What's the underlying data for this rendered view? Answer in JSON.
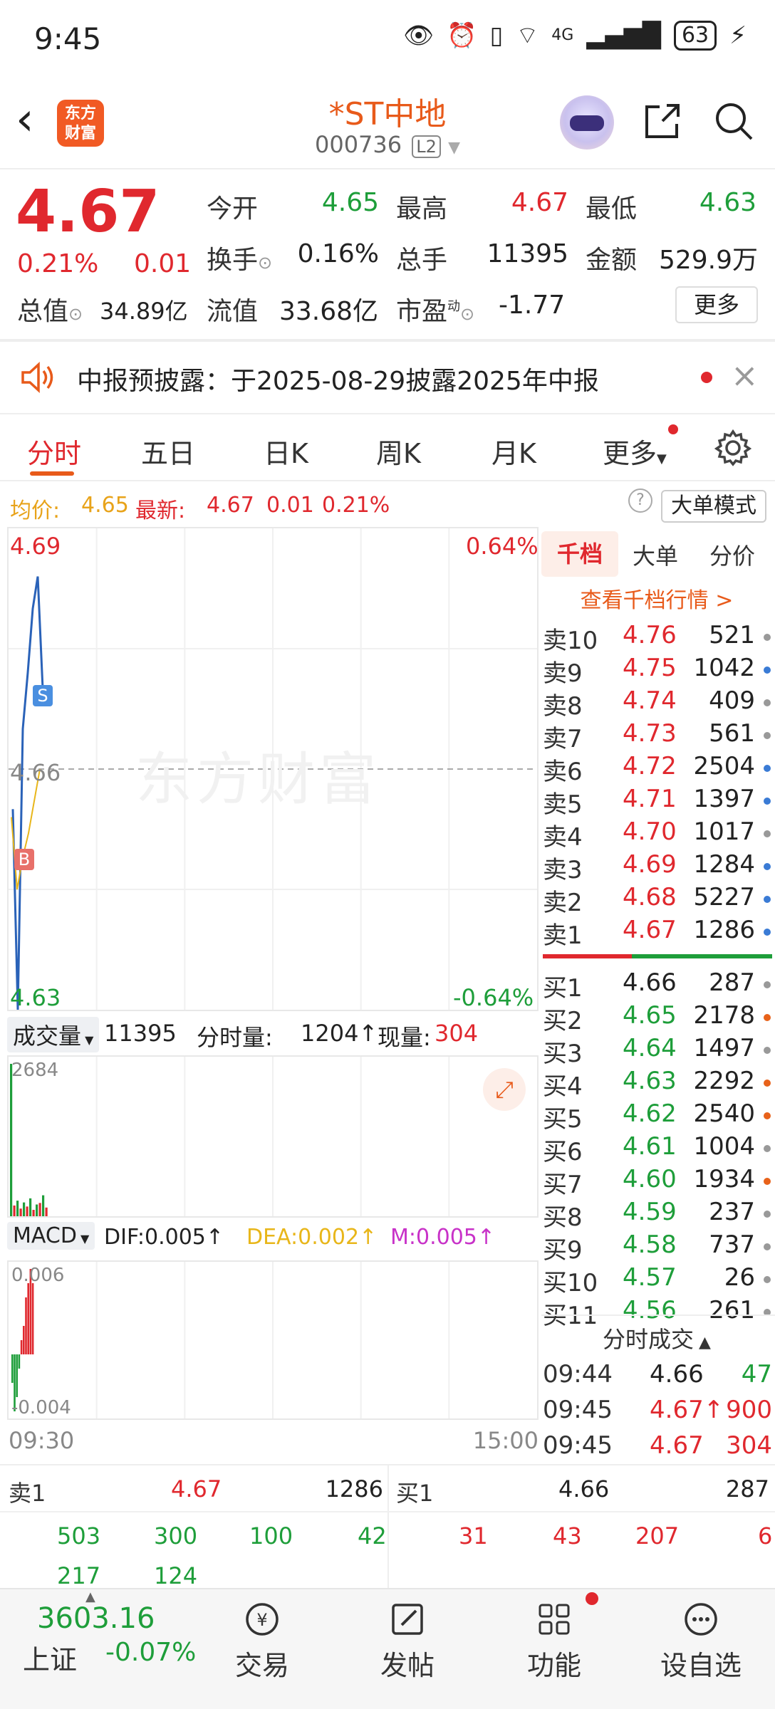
{
  "status": {
    "time": "9:45",
    "network": "4G",
    "battery": "63"
  },
  "header": {
    "logo_line1": "东方",
    "logo_line2": "财富",
    "stock_name": "*ST中地",
    "stock_code": "000736",
    "level_badge": "L2"
  },
  "quote": {
    "price": "4.67",
    "change_pct": "0.21%",
    "change_abs": "0.01",
    "open_label": "今开",
    "open": "4.65",
    "high_label": "最高",
    "high": "4.67",
    "low_label": "最低",
    "low": "4.63",
    "turnover_label": "换手",
    "turnover": "0.16%",
    "volume_label": "总手",
    "volume": "11395",
    "amount_label": "金额",
    "amount": "529.9万",
    "mktcap_label": "总值",
    "mktcap": "34.89亿",
    "float_label": "流值",
    "float_cap": "33.68亿",
    "pe_label": "市盈",
    "pe_sup": "动",
    "pe": "-1.77",
    "more_label": "更多"
  },
  "notice": {
    "text": "中报预披露：于2025-08-29披露2025年中报"
  },
  "tabs": [
    {
      "label": "分时"
    },
    {
      "label": "五日"
    },
    {
      "label": "日K"
    },
    {
      "label": "周K"
    },
    {
      "label": "月K"
    },
    {
      "label": "更多"
    }
  ],
  "subhead": {
    "avg_label": "均价:",
    "avg": "4.65",
    "latest_label": "最新:",
    "latest": "4.67",
    "latest_chg": "0.01",
    "latest_pct": "0.21%",
    "mode_btn": "大单模式"
  },
  "chart": {
    "y_top": "4.69",
    "y_mid": "4.66",
    "y_bottom": "4.63",
    "pct_top": "0.64%",
    "pct_bottom": "-0.64%",
    "watermark": "东方财富",
    "marker_b": "B",
    "marker_s": "S"
  },
  "volume": {
    "dropdown": "成交量",
    "total": "11395",
    "tick_label": "分时量:",
    "tick_val": "1204",
    "now_label": "现量:",
    "now_val": "304",
    "max": "2684"
  },
  "macd": {
    "dropdown": "MACD",
    "dif": "DIF:0.005",
    "dea": "DEA:0.002",
    "m": "M:0.005",
    "top": "0.006",
    "bottom": "-0.004"
  },
  "time_axis": {
    "start": "09:30",
    "end": "15:00"
  },
  "orderbook": {
    "tabs": [
      "千档",
      "大单",
      "分价"
    ],
    "link": "查看千档行情 >",
    "asks": [
      {
        "label": "卖10",
        "price": "4.76",
        "qty": "521",
        "dot": "#999999"
      },
      {
        "label": "卖9",
        "price": "4.75",
        "qty": "1042",
        "dot": "#3a7bd5"
      },
      {
        "label": "卖8",
        "price": "4.74",
        "qty": "409",
        "dot": "#999999"
      },
      {
        "label": "卖7",
        "price": "4.73",
        "qty": "561",
        "dot": "#999999"
      },
      {
        "label": "卖6",
        "price": "4.72",
        "qty": "2504",
        "dot": "#3a7bd5"
      },
      {
        "label": "卖5",
        "price": "4.71",
        "qty": "1397",
        "dot": "#3a7bd5"
      },
      {
        "label": "卖4",
        "price": "4.70",
        "qty": "1017",
        "dot": "#999999"
      },
      {
        "label": "卖3",
        "price": "4.69",
        "qty": "1284",
        "dot": "#3a7bd5"
      },
      {
        "label": "卖2",
        "price": "4.68",
        "qty": "5227",
        "dot": "#3a7bd5"
      },
      {
        "label": "卖1",
        "price": "4.67",
        "qty": "1286",
        "dot": "#3a7bd5"
      }
    ],
    "bids": [
      {
        "label": "买1",
        "price": "4.66",
        "qty": "287",
        "dot": "#999999"
      },
      {
        "label": "买2",
        "price": "4.65",
        "qty": "2178",
        "dot": "#e8621a"
      },
      {
        "label": "买3",
        "price": "4.64",
        "qty": "1497",
        "dot": "#999999"
      },
      {
        "label": "买4",
        "price": "4.63",
        "qty": "2292",
        "dot": "#e8621a"
      },
      {
        "label": "买5",
        "price": "4.62",
        "qty": "2540",
        "dot": "#e8621a"
      },
      {
        "label": "买6",
        "price": "4.61",
        "qty": "1004",
        "dot": "#999999"
      },
      {
        "label": "买7",
        "price": "4.60",
        "qty": "1934",
        "dot": "#e8621a"
      },
      {
        "label": "买8",
        "price": "4.59",
        "qty": "237",
        "dot": "#999999"
      },
      {
        "label": "买9",
        "price": "4.58",
        "qty": "737",
        "dot": "#999999"
      },
      {
        "label": "买10",
        "price": "4.57",
        "qty": "26",
        "dot": "#999999"
      },
      {
        "label": "买11",
        "price": "4.56",
        "qty": "261",
        "dot": "#999999"
      }
    ]
  },
  "ticks": {
    "title": "分时成交",
    "rows": [
      {
        "time": "09:44",
        "price": "4.66",
        "vol": "47"
      },
      {
        "time": "09:45",
        "price": "4.67",
        "vol": "900"
      },
      {
        "time": "09:45",
        "price": "4.67",
        "vol": "304"
      }
    ]
  },
  "bottom_queue": {
    "sell_label": "卖1",
    "sell_price": "4.67",
    "sell_qty": "1286",
    "buy_label": "买1",
    "buy_price": "4.66",
    "buy_qty": "287",
    "sell_orders_row1": [
      "503",
      "300",
      "100",
      "42"
    ],
    "sell_orders_row2": [
      "217",
      "124"
    ],
    "buy_orders_row1": [
      "31",
      "43",
      "207",
      "6"
    ]
  },
  "nav": {
    "index_value": "3603.16",
    "index_name": "上证",
    "index_change": "-0.07%",
    "items": [
      {
        "label": "交易"
      },
      {
        "label": "发帖"
      },
      {
        "label": "功能"
      },
      {
        "label": "设自选"
      }
    ]
  },
  "chart_data": {
    "type": "line",
    "series": [],
    "volume_values": [
      2684,
      420,
      610,
      300,
      540,
      380,
      700,
      250,
      460,
      520,
      820,
      340
    ],
    "macd_values": [
      -0.002,
      -0.004,
      -0.003,
      -0.001,
      0.001,
      0.002,
      0.004,
      0.005,
      0.006,
      0.005
    ],
    "price_line": [
      4.655,
      4.63,
      4.665,
      4.672,
      4.68,
      4.684,
      4.67
    ],
    "avg_line": [
      4.654,
      4.645,
      4.649,
      4.652,
      4.656,
      4.66
    ],
    "ylim": [
      4.63,
      4.69
    ]
  }
}
